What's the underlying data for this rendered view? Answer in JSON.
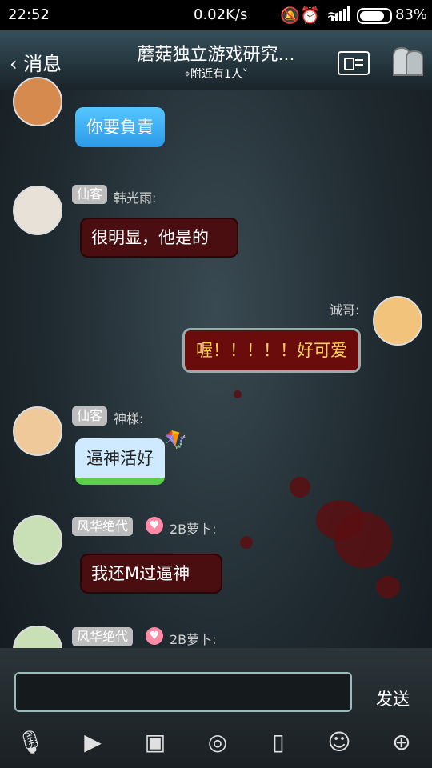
{
  "status_bar": {
    "time": "22:52",
    "net_speed": "0.02K/s",
    "battery": "83%"
  },
  "header": {
    "back_label": "消息",
    "title": "蘑菇独立游戏研究...",
    "subtitle": "附近有1人"
  },
  "messages": [
    {
      "text": "你要負責"
    },
    {
      "tag": "仙客",
      "name": "韩光雨:",
      "text": "很明显，他是的"
    },
    {
      "name": "诚哥:",
      "text": "喔！！！！！好可爱"
    },
    {
      "tag": "仙客",
      "name": "神様:",
      "text": "逼神活好"
    },
    {
      "tag": "风华绝代",
      "name": "2B萝卜:",
      "text": "我还M过逼神"
    },
    {
      "tag": "风华绝代",
      "name": "2B萝卜:"
    }
  ],
  "input": {
    "send_label": "发送"
  },
  "colors": {
    "dark_red": "#4a0e10",
    "blue": "#2c9ae8",
    "tag_gray": "#bdbdbd"
  },
  "toolbar_icons": [
    "microphone-icon",
    "video-icon",
    "image-icon",
    "camera-icon",
    "file-icon",
    "emoji-icon",
    "plus-icon"
  ]
}
